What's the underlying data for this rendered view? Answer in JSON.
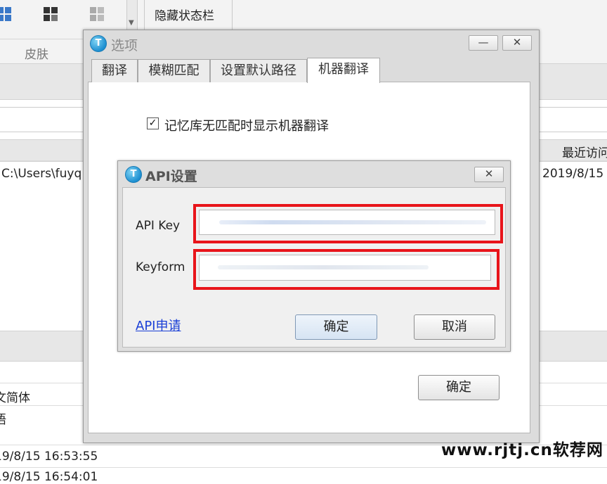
{
  "ribbon": {
    "hide_status_bar_label": "隐藏状态栏",
    "skin_group_label": "皮肤"
  },
  "background": {
    "path_cell": "C:\\Users\\fuyq",
    "recent_access_header": "最近访问",
    "recent_access_value": "2019/8/15",
    "language_row_1": "文简体",
    "language_row_2": "语",
    "timestamp_1": "19/8/15 16:53:55",
    "timestamp_2": "19/8/15 16:54:01"
  },
  "options_dialog": {
    "title": "选项",
    "logo_glyph": "T",
    "minimize_glyph": "—",
    "close_glyph": "✕",
    "tabs": [
      {
        "label": "翻译"
      },
      {
        "label": "模糊匹配"
      },
      {
        "label": "设置默认路径"
      },
      {
        "label": "机器翻译"
      }
    ],
    "active_tab": "机器翻译",
    "checkbox_label": "记忆库无匹配时显示机器翻译",
    "checkbox_checked": true,
    "checkbox_glyph": "✓",
    "ok_label": "确定"
  },
  "api_dialog": {
    "title": "API设置",
    "logo_glyph": "T",
    "close_glyph": "✕",
    "api_key_label": "API Key",
    "keyform_label": "Keyform",
    "apply_link": "API申请",
    "ok_label": "确定",
    "cancel_label": "取消",
    "highlight_color": "#e8141a"
  },
  "watermark": "www.rjtj.cn软荐网",
  "icons": [
    "ribbon-grid-icon",
    "ribbon-layout-icon",
    "ribbon-layout-gray-icon",
    "app-logo-icon",
    "minimize-icon",
    "close-icon",
    "check-icon"
  ]
}
